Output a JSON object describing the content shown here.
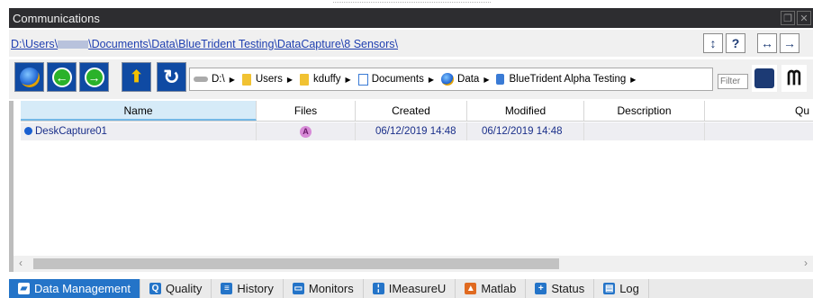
{
  "window": {
    "title": "Communications"
  },
  "path": {
    "prefix": "D:\\Users\\",
    "suffix": "\\Documents\\Data\\BlueTrident Testing\\DataCapture\\8 Sensors\\"
  },
  "path_buttons": [
    "↕",
    "?",
    "↔",
    "→"
  ],
  "breadcrumbs": [
    "D:\\",
    "Users",
    "kduffy",
    "Documents",
    "Data",
    "BlueTrident Alpha Testing"
  ],
  "filter": {
    "placeholder": "Filter"
  },
  "table": {
    "columns": [
      "Name",
      "Files",
      "Created",
      "Modified",
      "Description",
      "Qu"
    ],
    "rows": [
      {
        "name": "DeskCapture01",
        "files": "A",
        "created": "06/12/2019 14:48",
        "modified": "06/12/2019 14:48",
        "description": "",
        "quality": ""
      }
    ]
  },
  "tabs": [
    "Data Management",
    "Quality",
    "History",
    "Monitors",
    "IMeasureU",
    "Matlab",
    "Status",
    "Log"
  ],
  "colors": {
    "accent": "#2474c8",
    "titlebar": "#2d2d30",
    "toolbar_button": "#0f4aa3",
    "nav_green": "#2ab22a"
  }
}
